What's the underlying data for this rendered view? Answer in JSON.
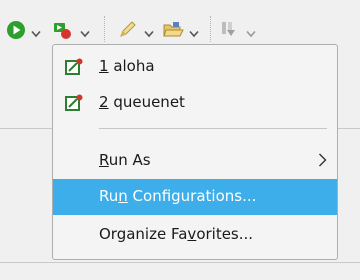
{
  "toolbar": {
    "icons": [
      "run-icon",
      "chevron-down-icon",
      "debug-icon",
      "chevron-down-icon",
      "edit-icon",
      "chevron-down-icon",
      "open-folder-icon",
      "chevron-down-icon",
      "download-icon",
      "chevron-down-icon"
    ]
  },
  "menu": {
    "recent_items": [
      {
        "mnemonic": "1",
        "name": " aloha",
        "icon": "launch-config-icon"
      },
      {
        "mnemonic": "2",
        "name": " queuenet",
        "icon": "launch-config-icon"
      }
    ],
    "run_as": {
      "pre": "",
      "mnemonic": "R",
      "post": "un As"
    },
    "run_configurations": {
      "pre": "Ru",
      "mnemonic": "n",
      "post": " Configurations..."
    },
    "organize_favorites": {
      "pre": "Organize Fa",
      "mnemonic": "v",
      "post": "orites..."
    },
    "submenu_arrow": ">"
  },
  "colors": {
    "selection": "#3daee9",
    "run_green": "#2e9e2e",
    "menu_bg": "#f4f4f4"
  }
}
